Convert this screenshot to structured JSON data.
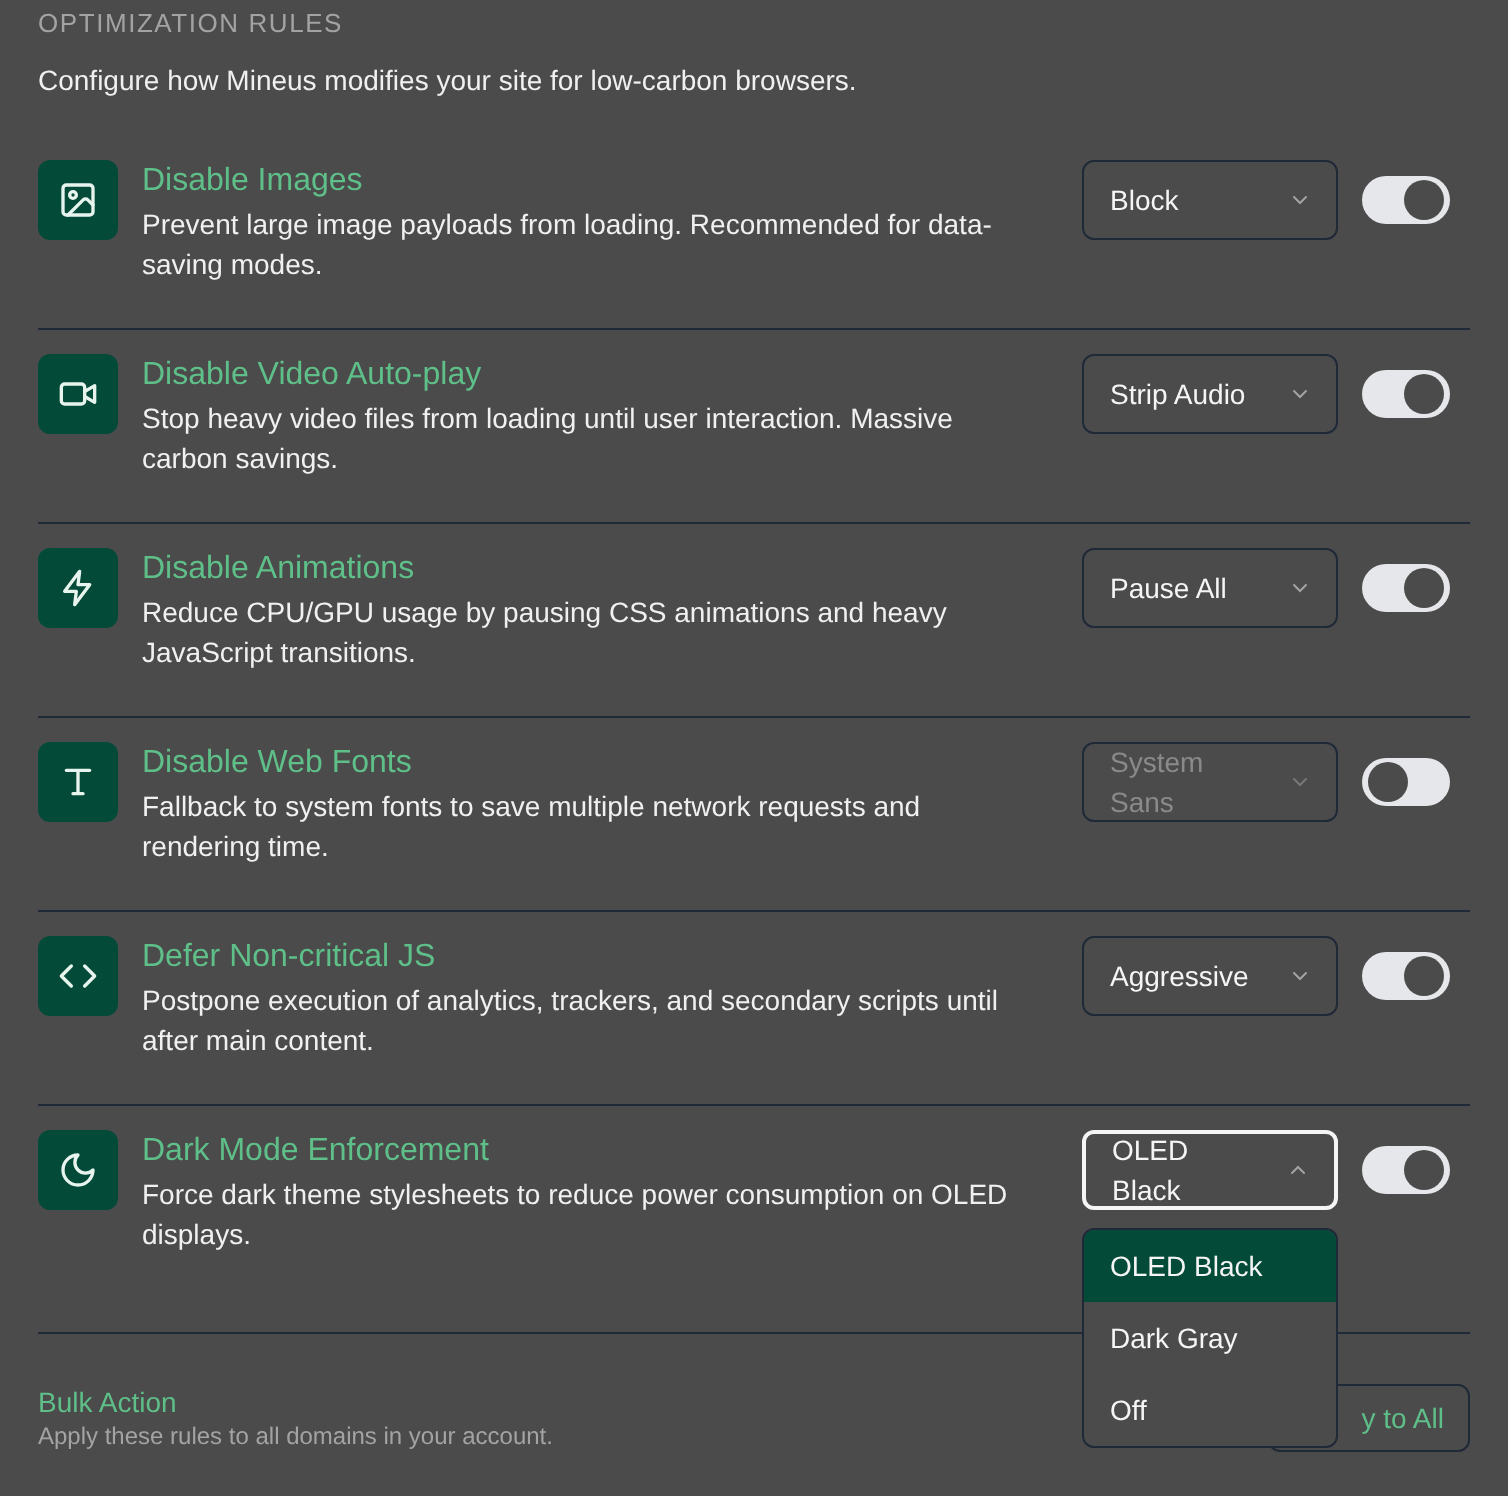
{
  "section_title": "OPTIMIZATION RULES",
  "section_description": "Configure how Mineus modifies your site for low-carbon browsers.",
  "rules": [
    {
      "kind": "image",
      "title": "Disable Images",
      "description": "Prevent large image payloads from loading. Recommended for data-saving modes.",
      "select": {
        "value": "Block",
        "disabled": false,
        "expanded": false
      },
      "on": true
    },
    {
      "kind": "video",
      "title": "Disable Video Auto-play",
      "description": "Stop heavy video files from loading until user interaction. Massive carbon savings.",
      "select": {
        "value": "Strip Audio",
        "disabled": false,
        "expanded": false
      },
      "on": true
    },
    {
      "kind": "bolt",
      "title": "Disable Animations",
      "description": "Reduce CPU/GPU usage by pausing CSS animations and heavy JavaScript transitions.",
      "select": {
        "value": "Pause All",
        "disabled": false,
        "expanded": false
      },
      "on": true
    },
    {
      "kind": "type",
      "title": "Disable Web Fonts",
      "description": "Fallback to system fonts to save multiple network requests and rendering time.",
      "select": {
        "value": "System Sans",
        "disabled": true,
        "expanded": false
      },
      "on": false
    },
    {
      "kind": "code",
      "title": "Defer Non-critical JS",
      "description": "Postpone execution of analytics, trackers, and secondary scripts until after main content.",
      "select": {
        "value": "Aggressive",
        "disabled": false,
        "expanded": false
      },
      "on": true
    },
    {
      "kind": "moon",
      "title": "Dark Mode Enforcement",
      "description": "Force dark theme stylesheets to reduce power consumption on OLED displays.",
      "select": {
        "value": "OLED Black",
        "disabled": false,
        "expanded": true,
        "options": [
          {
            "label": "OLED Black",
            "selected": true
          },
          {
            "label": "Dark Gray",
            "selected": false
          },
          {
            "label": "Off",
            "selected": false
          }
        ]
      },
      "on": true
    }
  ],
  "bulk_action": {
    "title": "Bulk Action",
    "description": "Apply these rules to all domains in your account.",
    "button": "y to All"
  }
}
